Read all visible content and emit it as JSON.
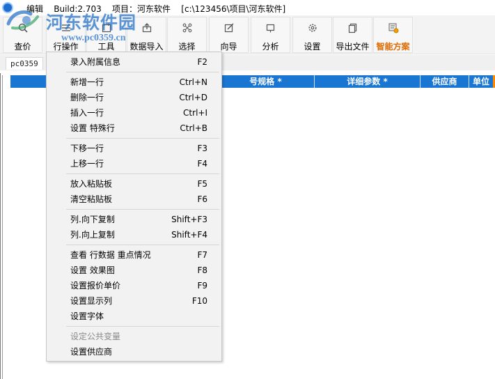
{
  "titlebar": {
    "text": "编辑    Build:2.703    项目：河东软件    [c:\\123456\\项目\\河东软件]"
  },
  "toolbar": {
    "buttons": [
      {
        "label": "查价",
        "icon": "search-icon"
      },
      {
        "label": "行操作",
        "icon": "rows-icon"
      },
      {
        "label": "工具",
        "icon": "tools-icon"
      },
      {
        "label": "数据导入",
        "icon": "import-icon"
      },
      {
        "label": "选择",
        "icon": "select-icon"
      },
      {
        "label": "向导",
        "icon": "wizard-icon"
      },
      {
        "label": "分析",
        "icon": "analysis-icon"
      },
      {
        "label": "设置",
        "icon": "gear-icon"
      },
      {
        "label": "导出文件",
        "icon": "export-icon"
      },
      {
        "label": "智能方案",
        "icon": "smart-plan-icon",
        "accent": "#e06a00"
      }
    ]
  },
  "tabs": [
    {
      "label": "pc0359"
    }
  ],
  "grid": {
    "columns": [
      {
        "label": ""
      },
      {
        "label": "号规格 *"
      },
      {
        "label": "详细参数 *"
      },
      {
        "label": "供应商"
      },
      {
        "label": "单位"
      }
    ],
    "header_color": "#1976d2"
  },
  "context_menu": {
    "items": [
      {
        "label": "录入附属信息",
        "shortcut": "F2"
      },
      {
        "label": "新增一行",
        "shortcut": "Ctrl+N"
      },
      {
        "label": "删除一行",
        "shortcut": "Ctrl+D"
      },
      {
        "label": "插入一行",
        "shortcut": "Ctrl+I"
      },
      {
        "label": "设置 特殊行",
        "shortcut": "Ctrl+B"
      },
      {
        "label": "下移一行",
        "shortcut": "F3"
      },
      {
        "label": "上移一行",
        "shortcut": "F4"
      },
      {
        "label": "放入粘贴板",
        "shortcut": "F5"
      },
      {
        "label": "清空粘贴板",
        "shortcut": "F6"
      },
      {
        "label": "列.向下复制",
        "shortcut": "Shift+F3"
      },
      {
        "label": "列.向上复制",
        "shortcut": "Shift+F4"
      },
      {
        "label": "查看 行数据 重点情况",
        "shortcut": "F7"
      },
      {
        "label": "设置 效果图",
        "shortcut": "F8"
      },
      {
        "label": "设置报价单价",
        "shortcut": "F9"
      },
      {
        "label": "设置显示列",
        "shortcut": "F10"
      },
      {
        "label": "设置字体",
        "shortcut": ""
      },
      {
        "label": "设定公共变量",
        "shortcut": "",
        "disabled": true
      },
      {
        "label": "设置供应商",
        "shortcut": ""
      }
    ]
  },
  "watermark": {
    "title": "河东软件园",
    "url": "www.pc0359.cn"
  }
}
